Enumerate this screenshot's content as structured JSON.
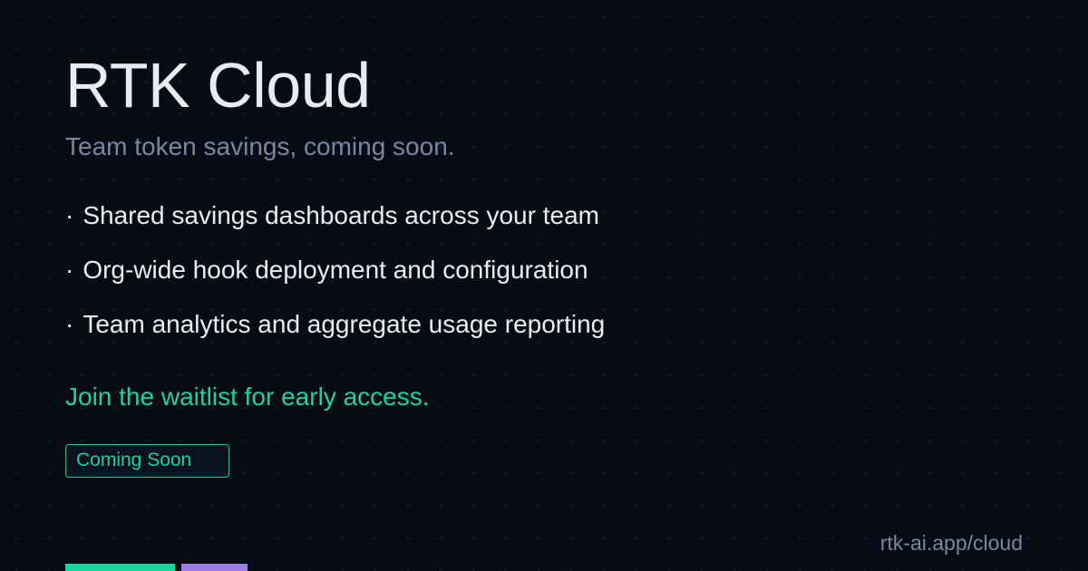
{
  "title": "RTK Cloud",
  "subtitle": "Team token savings, coming soon.",
  "bullet_glyph": "·",
  "features": [
    "Shared savings dashboards across your team",
    "Org-wide hook deployment and configuration",
    "Team analytics and aggregate usage reporting"
  ],
  "cta": "Join the waitlist for early access.",
  "badge": {
    "label": "Coming Soon"
  },
  "url": "rtk-ai.app/cloud",
  "colors": {
    "background": "#070b16",
    "title": "#e6ebf5",
    "muted": "#7b879c",
    "accent_green": "#19d49b",
    "accent_purple": "#9b7be6"
  }
}
